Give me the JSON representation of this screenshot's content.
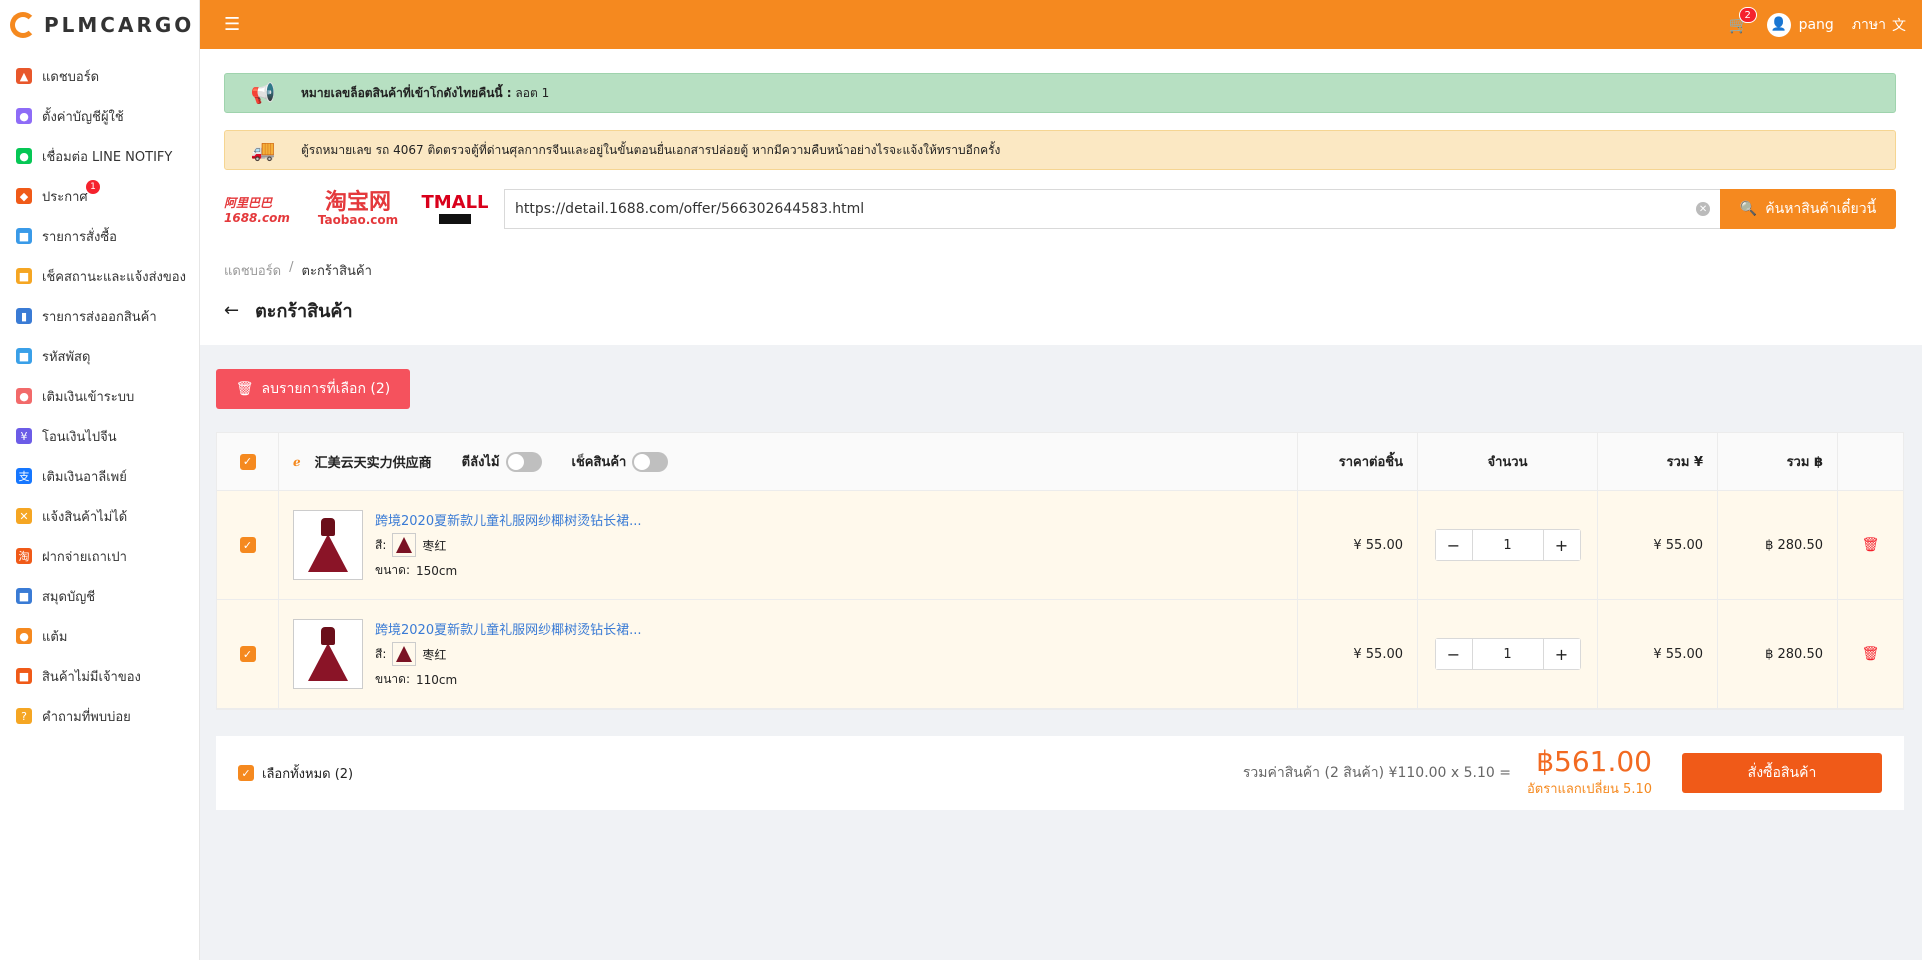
{
  "brand": {
    "name": "PLMCARGO",
    "accent": "#f5891f"
  },
  "sidebar": {
    "items": [
      {
        "label": "แดชบอร์ด",
        "icon": "chart-icon",
        "color": "#e8572b"
      },
      {
        "label": "ตั้งค่าบัญชีผู้ใช้",
        "icon": "user-settings-icon",
        "color": "#8e6cf7"
      },
      {
        "label": "เชื่อมต่อ LINE NOTIFY",
        "icon": "line-icon",
        "color": "#06c755"
      },
      {
        "label": "ประกาศ",
        "icon": "megaphone-icon",
        "color": "#f05a18",
        "badge": "1"
      },
      {
        "label": "รายการสั่งซื้อ",
        "icon": "shopping-bag-icon",
        "color": "#3a9ae8"
      },
      {
        "label": "เช็คสถานะและแจ้งส่งของ",
        "icon": "truck-icon",
        "color": "#f5a623"
      },
      {
        "label": "รายการส่งออกสินค้า",
        "icon": "hand-truck-icon",
        "color": "#3a7bd5"
      },
      {
        "label": "รหัสพัสดุ",
        "icon": "box-icon",
        "color": "#3aa0e8"
      },
      {
        "label": "เติมเงินเข้าระบบ",
        "icon": "piggy-bank-icon",
        "color": "#f26a6a"
      },
      {
        "label": "โอนเงินไปจีน",
        "icon": "yuan-icon",
        "color": "#6c5ce7"
      },
      {
        "label": "เติมเงินอาลีเพย์",
        "icon": "alipay-icon",
        "color": "#1677ff"
      },
      {
        "label": "แจ้งสินค้าไม่ได้",
        "icon": "report-icon",
        "color": "#f5a623"
      },
      {
        "label": "ฝากจ่ายเถาเปา",
        "icon": "taobao-icon",
        "color": "#f05a18"
      },
      {
        "label": "สมุดบัญชี",
        "icon": "wallet-icon",
        "color": "#3a7bd5"
      },
      {
        "label": "แต้ม",
        "icon": "points-icon",
        "color": "#f5891f"
      },
      {
        "label": "สินค้าไม่มีเจ้าของ",
        "icon": "search-box-icon",
        "color": "#f05a18"
      },
      {
        "label": "คำถามที่พบบ่อย",
        "icon": "question-icon",
        "color": "#f5a623"
      }
    ]
  },
  "header": {
    "cart_count": "2",
    "username": "pang",
    "language_label": "ภาษา"
  },
  "alerts": {
    "green": {
      "bold": "หมายเลขล็อตสินค้าที่เข้าโกดังไทยคืนนี้ :",
      "text": " ลอต 1"
    },
    "yellow": {
      "text": "ตู้รถหมายเลข รถ 4067 ติดตรวจตู้ที่ด่านศุลกากรจีนและอยู่ในขั้นตอนยื่นเอกสารปล่อยตู้ หากมีความคืบหน้าอย่างไรจะแจ้งให้ทราบอีกครั้ง"
    }
  },
  "search": {
    "logo_1688": "阿里巴巴 1688.com",
    "logo_taobao_cn": "淘宝网",
    "logo_taobao_en": "Taobao.com",
    "logo_tmall": "TMALL",
    "value": "https://detail.1688.com/offer/566302644583.html",
    "button_label": "ค้นหาสินค้าเดี๋ยวนี้"
  },
  "breadcrumb": {
    "home": "แดชบอร์ด",
    "separator": "/",
    "current": "ตะกร้าสินค้า"
  },
  "page_title": "ตะกร้าสินค้า",
  "delete_selected_label": "ลบรายการที่เลือก (2)",
  "table": {
    "shop_name": "汇美云天实力供应商",
    "toggle_wood_label": "ตีลังไม้",
    "toggle_check_label": "เช็คสินค้า",
    "col_price": "ราคาต่อชิ้น",
    "col_qty": "จำนวน",
    "col_total_cny": "รวม ¥",
    "col_total_thb": "รวม ฿",
    "rows": [
      {
        "name": "跨境2020夏新款儿童礼服网纱椰树烫钻长裙...",
        "color_label": "สี:",
        "color_value": "枣红",
        "size_label": "ขนาด:",
        "size_value": "150cm",
        "price": "¥ 55.00",
        "qty": "1",
        "total_cny": "¥ 55.00",
        "total_thb": "฿ 280.50"
      },
      {
        "name": "跨境2020夏新款儿童礼服网纱椰树烫钻长裙...",
        "color_label": "สี:",
        "color_value": "枣红",
        "size_label": "ขนาด:",
        "size_value": "110cm",
        "price": "¥ 55.00",
        "qty": "1",
        "total_cny": "¥ 55.00",
        "total_thb": "฿ 280.50"
      }
    ]
  },
  "summary": {
    "select_all_label": "เลือกทั้งหมด (2)",
    "total_text": "รวมค่าสินค้า (2 สินค้า)  ¥110.00 x 5.10 =",
    "total_amount": "฿561.00",
    "rate_text": "อัตราแลกเปลี่ยน 5.10",
    "order_button": "สั่งซื้อสินค้า"
  }
}
